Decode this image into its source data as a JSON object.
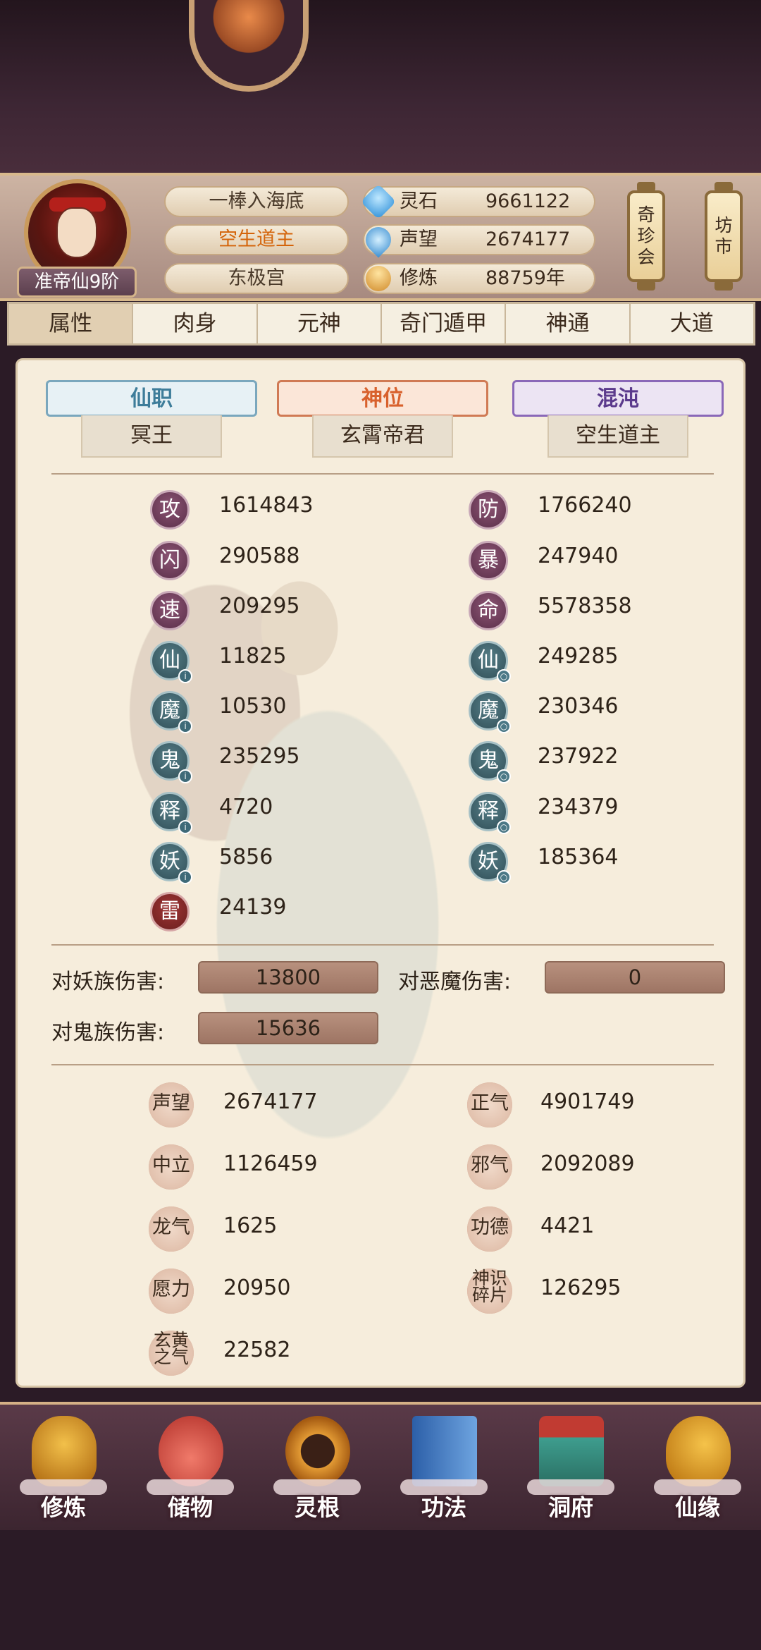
{
  "header": {
    "rank": "准帝仙9阶",
    "titles": [
      "一棒入海底",
      "空生道主",
      "东极宫"
    ],
    "resources": [
      {
        "icon": "spirit-stone-icon",
        "label": "灵石",
        "value": "9661122"
      },
      {
        "icon": "reputation-icon",
        "label": "声望",
        "value": "2674177"
      },
      {
        "icon": "cultivation-icon",
        "label": "修炼",
        "value": "88759年"
      }
    ],
    "side_buttons": [
      {
        "lines": [
          "奇",
          "珍",
          "会"
        ]
      },
      {
        "lines": [
          "坊",
          "市"
        ]
      }
    ]
  },
  "tabs": [
    "属性",
    "肉身",
    "元神",
    "奇门遁甲",
    "神通",
    "大道"
  ],
  "active_tab": "属性",
  "positions": [
    {
      "title": "仙职",
      "value": "冥王",
      "style": "blue"
    },
    {
      "title": "神位",
      "value": "玄霄帝君",
      "style": "orange"
    },
    {
      "title": "混沌",
      "value": "空生道主",
      "style": "purple"
    }
  ],
  "stats_left": [
    {
      "char": "攻",
      "value": "1614843",
      "style": "purple"
    },
    {
      "char": "闪",
      "value": "290588",
      "style": "purple"
    },
    {
      "char": "速",
      "value": "209295",
      "style": "purple"
    },
    {
      "char": "仙",
      "value": "11825",
      "style": "teal",
      "dot": "i"
    },
    {
      "char": "魔",
      "value": "10530",
      "style": "teal",
      "dot": "i"
    },
    {
      "char": "鬼",
      "value": "235295",
      "style": "teal",
      "dot": "i"
    },
    {
      "char": "释",
      "value": "4720",
      "style": "teal",
      "dot": "i"
    },
    {
      "char": "妖",
      "value": "5856",
      "style": "teal",
      "dot": "i"
    },
    {
      "char": "雷",
      "value": "24139",
      "style": "red"
    }
  ],
  "stats_right": [
    {
      "char": "防",
      "value": "1766240",
      "style": "purple"
    },
    {
      "char": "暴",
      "value": "247940",
      "style": "purple"
    },
    {
      "char": "命",
      "value": "5578358",
      "style": "purple"
    },
    {
      "char": "仙",
      "value": "249285",
      "style": "teal",
      "dot": "o"
    },
    {
      "char": "魔",
      "value": "230346",
      "style": "teal",
      "dot": "o"
    },
    {
      "char": "鬼",
      "value": "237922",
      "style": "teal",
      "dot": "o"
    },
    {
      "char": "释",
      "value": "234379",
      "style": "teal",
      "dot": "o"
    },
    {
      "char": "妖",
      "value": "185364",
      "style": "teal",
      "dot": "o"
    }
  ],
  "damage": [
    {
      "label": "对妖族伤害:",
      "value": "13800"
    },
    {
      "label": "对恶魔伤害:",
      "value": "0"
    },
    {
      "label": "对鬼族伤害:",
      "value": "15636"
    }
  ],
  "reputation_left": [
    {
      "label": "声望",
      "value": "2674177"
    },
    {
      "label": "中立",
      "value": "1126459"
    },
    {
      "label": "龙气",
      "value": "1625"
    },
    {
      "label": "愿力",
      "value": "20950"
    },
    {
      "label": "玄黄之气",
      "value": "22582"
    }
  ],
  "reputation_right": [
    {
      "label": "正气",
      "value": "4901749"
    },
    {
      "label": "邪气",
      "value": "2092089"
    },
    {
      "label": "功德",
      "value": "4421"
    },
    {
      "label": "神识碎片",
      "value": "126295"
    }
  ],
  "bottom_nav": [
    {
      "label": "修炼",
      "icon": "cultivate-icon"
    },
    {
      "label": "储物",
      "icon": "storage-bag-icon"
    },
    {
      "label": "灵根",
      "icon": "spirit-root-icon"
    },
    {
      "label": "功法",
      "icon": "technique-book-icon"
    },
    {
      "label": "洞府",
      "icon": "cave-dwelling-icon"
    },
    {
      "label": "仙缘",
      "icon": "immortal-fate-icon"
    }
  ]
}
